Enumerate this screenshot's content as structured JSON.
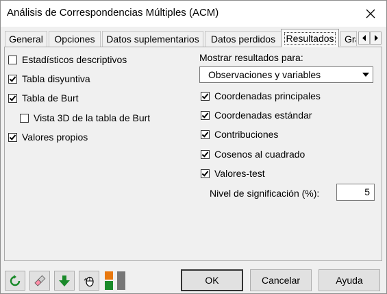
{
  "window": {
    "title": "Análisis de Correspondencias Múltiples (ACM)",
    "close_icon": "close-icon"
  },
  "tabs": [
    {
      "label": "General"
    },
    {
      "label": "Opciones"
    },
    {
      "label": "Datos suplementarios"
    },
    {
      "label": "Datos perdidos"
    },
    {
      "label": "Resultados",
      "active": true
    },
    {
      "label": "Gráficos"
    }
  ],
  "left_options": [
    {
      "label": "Estadísticos descriptivos",
      "checked": false
    },
    {
      "label": "Tabla disyuntiva",
      "checked": true
    },
    {
      "label": "Tabla de Burt",
      "checked": true
    },
    {
      "label": "Vista 3D de la tabla de Burt",
      "checked": false
    },
    {
      "label": "Valores propios",
      "checked": true
    }
  ],
  "results_for": {
    "label": "Mostrar resultados para:",
    "selected": "Observaciones y variables"
  },
  "right_options": [
    {
      "label": "Coordenadas principales",
      "checked": true
    },
    {
      "label": "Coordenadas estándar",
      "checked": true
    },
    {
      "label": "Contribuciones",
      "checked": true
    },
    {
      "label": "Cosenos al cuadrado",
      "checked": true
    },
    {
      "label": "Valores-test",
      "checked": true
    }
  ],
  "significance": {
    "label": "Nivel de significación (%):",
    "value": "5"
  },
  "footer": {
    "ok": "OK",
    "cancel": "Cancelar",
    "help": "Ayuda",
    "tools": [
      "reset-icon",
      "eraser-icon",
      "download-icon",
      "mouse-icon",
      "layout-icon"
    ],
    "colors": {
      "green": "#1a8a2a",
      "orange": "#e8780e"
    }
  }
}
